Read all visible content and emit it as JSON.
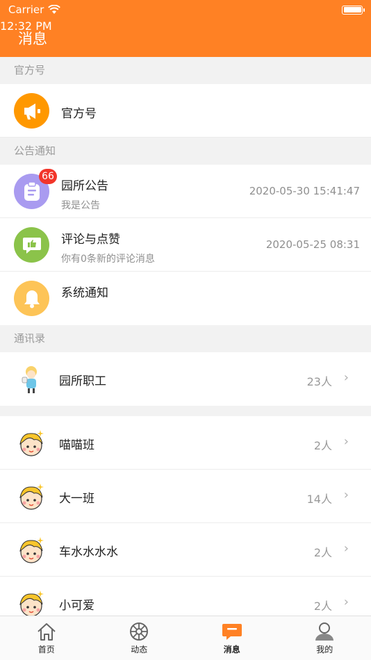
{
  "status_bar": {
    "carrier": "Carrier",
    "time": "12:32 PM"
  },
  "header": {
    "title": "消息"
  },
  "sections": {
    "official": "官方号",
    "notices": "公告通知",
    "contacts": "通讯录"
  },
  "official_row": {
    "name": "官方号"
  },
  "notices": [
    {
      "name": "园所公告",
      "sub": "我是公告",
      "time": "2020-05-30 15:41:47",
      "badge": "66"
    },
    {
      "name": "评论与点赞",
      "sub": "你有0条新的评论消息",
      "time": "2020-05-25 08:31"
    },
    {
      "name": "系统通知"
    }
  ],
  "staff": {
    "name": "园所职工",
    "count": "23人"
  },
  "classes": [
    {
      "name": "喵喵班",
      "count": "2人"
    },
    {
      "name": "大一班",
      "count": "14人"
    },
    {
      "name": "车水水水水",
      "count": "2人"
    },
    {
      "name": "小可爱",
      "count": "2人"
    }
  ],
  "tabs": [
    {
      "label": "首页",
      "icon": "home-icon"
    },
    {
      "label": "动态",
      "icon": "wheel-icon"
    },
    {
      "label": "消息",
      "icon": "message-icon",
      "active": true
    },
    {
      "label": "我的",
      "icon": "user-icon"
    }
  ],
  "colors": {
    "accent": "#FF8124",
    "badge": "#F2352A",
    "official": "#FF9800",
    "notice": "#A99BF0",
    "comment": "#8BC34A",
    "system": "#FDC457"
  }
}
